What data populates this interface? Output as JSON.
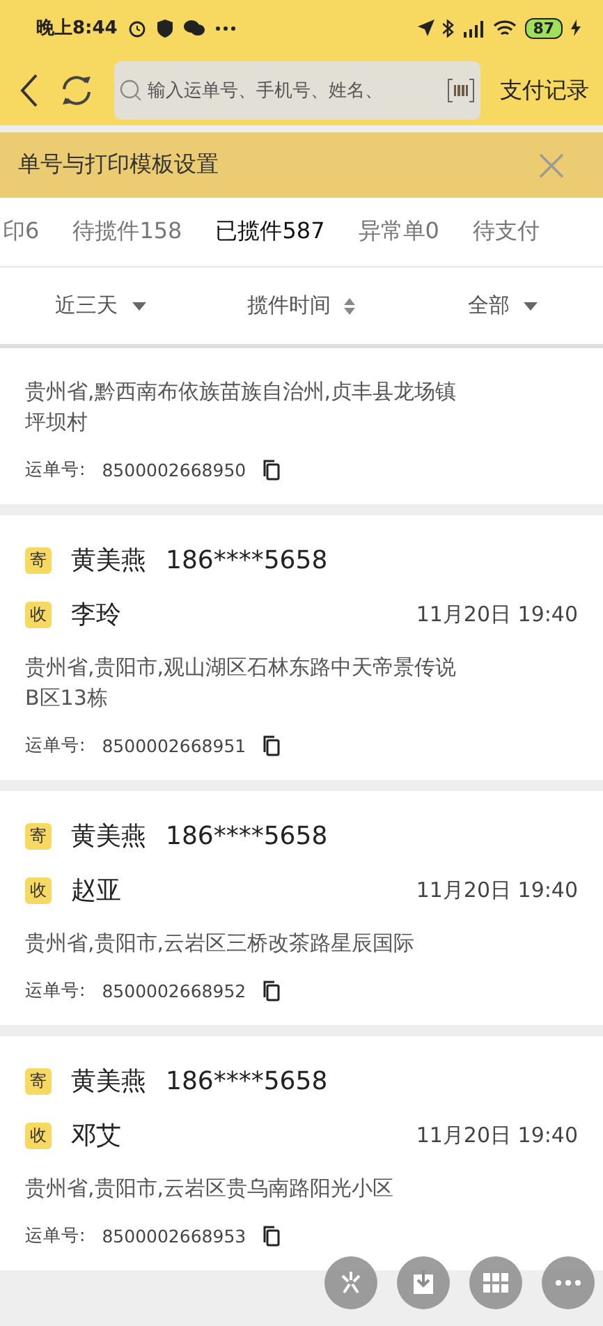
{
  "status_bar": {
    "time": "晚上8:44",
    "battery": "87"
  },
  "header": {
    "search": {
      "placeholder": "输入运单号、手机号、姓名、"
    },
    "action": "支付记录"
  },
  "banner": {
    "text": "单号与打印模板设置"
  },
  "tabs": [
    {
      "label": "印6",
      "selected": false
    },
    {
      "label": "待揽件158",
      "selected": false
    },
    {
      "label": "已揽件587",
      "selected": true
    },
    {
      "label": "异常单0",
      "selected": false
    },
    {
      "label": "待支付",
      "selected": false
    }
  ],
  "filters": [
    {
      "label": "近三天",
      "kind": "dropdown"
    },
    {
      "label": "揽件时间",
      "kind": "sort"
    },
    {
      "label": "全部",
      "kind": "dropdown"
    }
  ],
  "orders": [
    {
      "address": "贵州省,黔西南布依族苗族自治州,贞丰县龙场镇坪坝村",
      "waybill_label": "运单号:",
      "waybill": "8500002668950"
    },
    {
      "sender_badge": "寄",
      "sender": "黄美燕",
      "sender_phone": "186****5658",
      "receiver_badge": "收",
      "receiver": "李玲",
      "time": "11月20日 19:40",
      "address": "贵州省,贵阳市,观山湖区石林东路中天帝景传说B区13栋",
      "waybill_label": "运单号:",
      "waybill": "8500002668951"
    },
    {
      "sender_badge": "寄",
      "sender": "黄美燕",
      "sender_phone": "186****5658",
      "receiver_badge": "收",
      "receiver": "赵亚",
      "time": "11月20日 19:40",
      "address": "贵州省,贵阳市,云岩区三桥改茶路星辰国际",
      "waybill_label": "运单号:",
      "waybill": "8500002668952"
    },
    {
      "sender_badge": "寄",
      "sender": "黄美燕",
      "sender_phone": "186****5658",
      "receiver_badge": "收",
      "receiver": "邓艾",
      "time": "11月20日 19:40",
      "address": "贵州省,贵阳市,云岩区贵乌南路阳光小区",
      "waybill_label": "运单号:",
      "waybill": "8500002668953"
    }
  ],
  "fab_buttons": [
    {
      "kind": "burst"
    },
    {
      "kind": "download"
    },
    {
      "kind": "grid"
    },
    {
      "kind": "more"
    }
  ]
}
